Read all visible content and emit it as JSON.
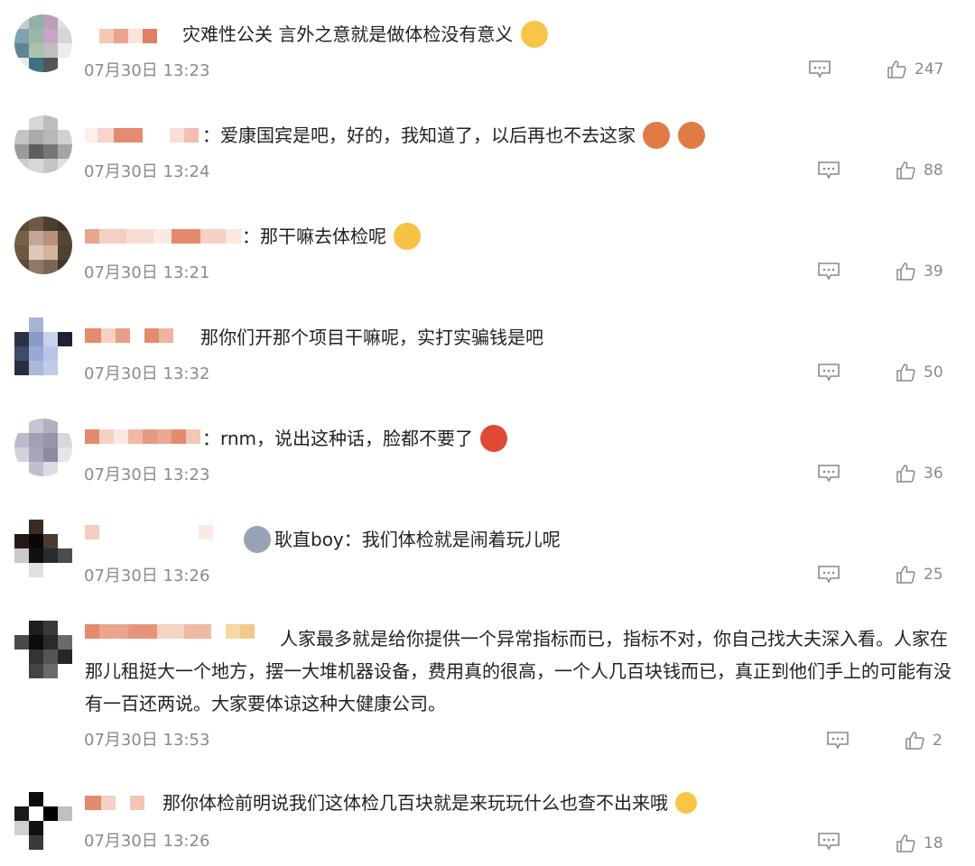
{
  "comments": [
    {
      "text": "灾难性公关 言外之意就是做体检没有意义",
      "time": "07月30日 13:23",
      "likes": "247",
      "emoji": "😬"
    },
    {
      "text": "：爱康国宾是吧，好的，我知道了，以后再也不去这家",
      "time": "07月30日 13:24",
      "likes": "88",
      "emoji": "😫😫"
    },
    {
      "text": "：那干嘛去体检呢",
      "time": "07月30日 13:21",
      "likes": "39",
      "emoji": "😓"
    },
    {
      "text": "那你们开那个项目干嘛呢，实打实骗钱是吧",
      "time": "07月30日 13:32",
      "likes": "50"
    },
    {
      "text": "：rnm，说出这种话，脸都不要了",
      "time": "07月30日 13:23",
      "likes": "36",
      "emoji": "😡"
    },
    {
      "text": "耿直boy：我们体检就是闹着玩儿呢",
      "time": "07月30日 13:26",
      "likes": "25"
    },
    {
      "text": "人家最多就是给你提供一个异常指标而已，指标不对，你自己找大夫深入看。人家在那儿租挺大一个地方，摆一大堆机器设备，费用真的很高，一个人几百块钱而已，真正到他们手上的可能有没有一百还两说。大家要体谅这种大健康公司。",
      "time": "07月30日 13:53",
      "likes": "2"
    },
    {
      "text": "那你体检前明说我们这体检几百块就是来玩玩什么也查不出来哦",
      "time": "07月30日 13:26",
      "likes": "18",
      "emoji": "🙄"
    }
  ]
}
